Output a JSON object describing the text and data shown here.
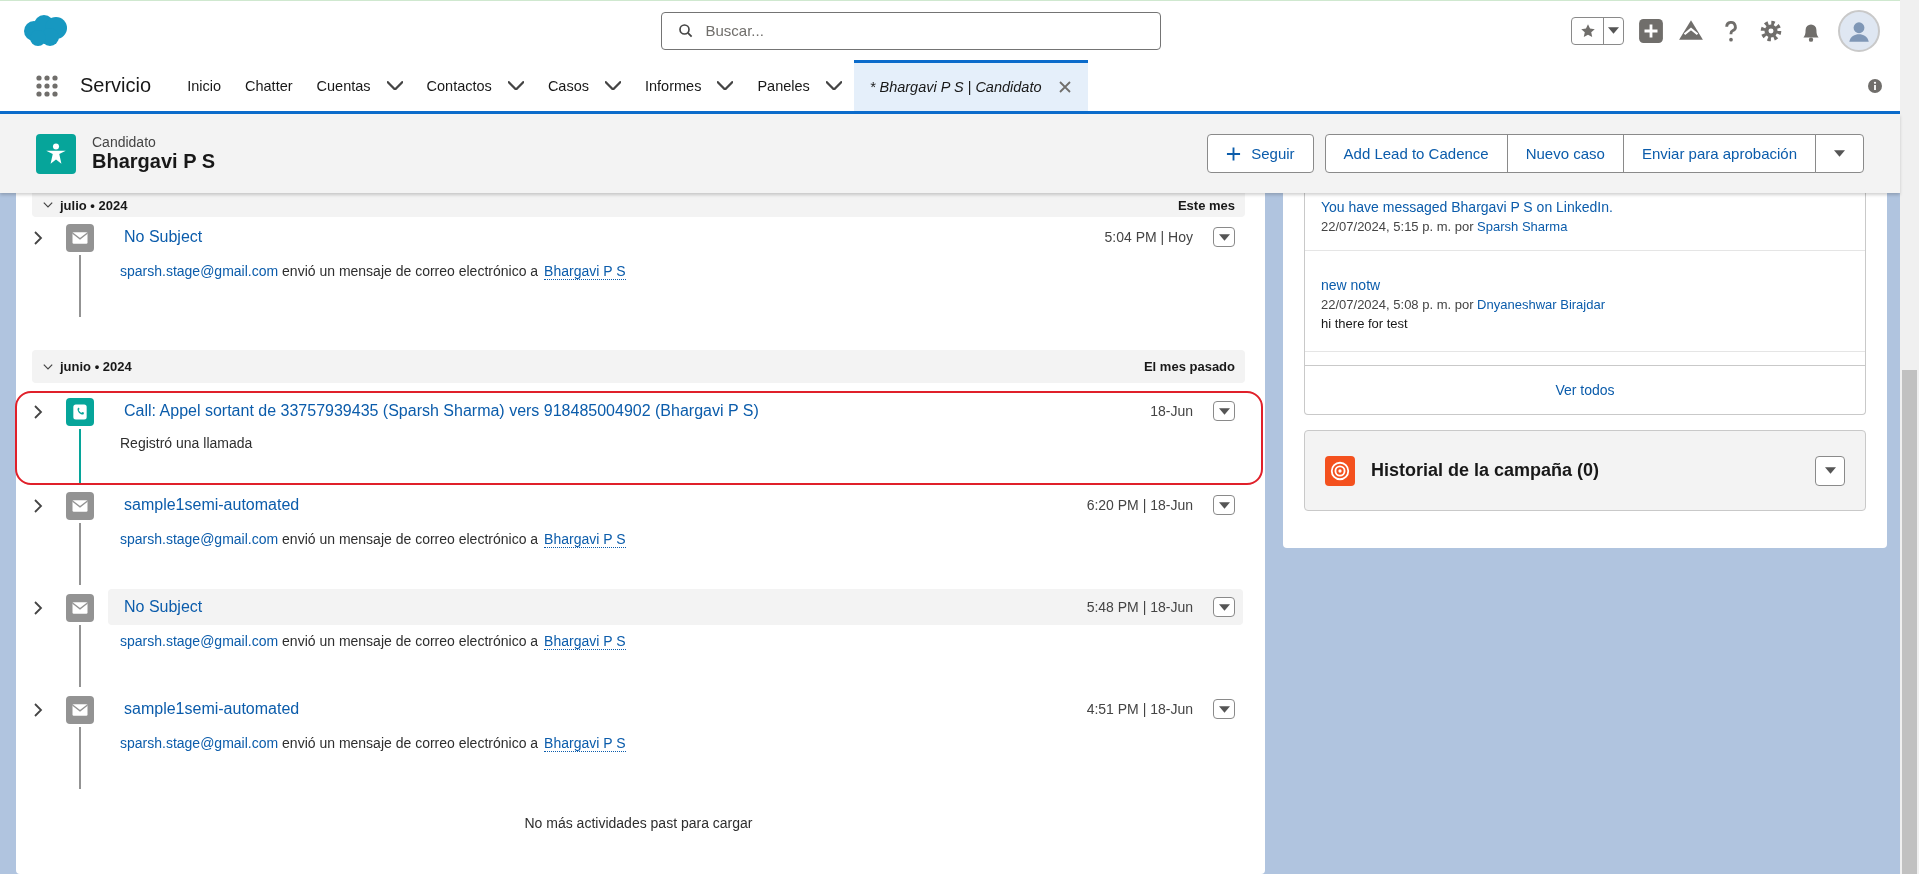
{
  "header": {
    "search": {
      "placeholder": "Buscar..."
    }
  },
  "nav": {
    "app_name": "Servicio",
    "tabs": [
      {
        "label": "Inicio",
        "has_menu": false
      },
      {
        "label": "Chatter",
        "has_menu": false
      },
      {
        "label": "Cuentas",
        "has_menu": true
      },
      {
        "label": "Contactos",
        "has_menu": true
      },
      {
        "label": "Casos",
        "has_menu": true
      },
      {
        "label": "Informes",
        "has_menu": true
      },
      {
        "label": "Paneles",
        "has_menu": true
      }
    ],
    "workspace_tabs": [
      {
        "label": "* Bhargavi P S | Candidato",
        "selected": true
      }
    ]
  },
  "record": {
    "object_type": "Candidato",
    "name": "Bhargavi P S",
    "actions": [
      {
        "label": "Seguir",
        "kind": "follow"
      },
      {
        "label": "Add Lead to Cadence",
        "kind": "action"
      },
      {
        "label": "Nuevo caso",
        "kind": "action"
      },
      {
        "label": "Enviar para aprobación",
        "kind": "action"
      }
    ]
  },
  "timeline": {
    "groups": [
      {
        "label": "julio • 2024",
        "relative": "Este mes",
        "expanded": true,
        "activities": [
          {
            "kind": "email",
            "title": "No Subject",
            "time": "5:04 PM | Hoy",
            "sender": "sparsh.stage@gmail.com",
            "action": "envió un mensaje de correo electrónico a",
            "recipient": "Bhargavi P S",
            "highlighted": false,
            "hovered": false
          }
        ]
      },
      {
        "label": "junio • 2024",
        "relative": "El mes pasado",
        "expanded": true,
        "activities": [
          {
            "kind": "call",
            "title": "Call: Appel sortant de 33757939435 (Sparsh Sharma) vers 918485004902 (Bhargavi P S)",
            "time": "18-Jun",
            "description": "Registró una llamada",
            "highlighted": true,
            "hovered": false
          },
          {
            "kind": "email",
            "title": "sample1semi-automated",
            "time": "6:20 PM | 18-Jun",
            "sender": "sparsh.stage@gmail.com",
            "action": "envió un mensaje de correo electrónico a",
            "recipient": "Bhargavi P S",
            "highlighted": false,
            "hovered": false
          },
          {
            "kind": "email",
            "title": "No Subject",
            "time": "5:48 PM | 18-Jun",
            "sender": "sparsh.stage@gmail.com",
            "action": "envió un mensaje de correo electrónico a",
            "recipient": "Bhargavi P S",
            "highlighted": false,
            "hovered": true
          },
          {
            "kind": "email",
            "title": "sample1semi-automated",
            "time": "4:51 PM | 18-Jun",
            "sender": "sparsh.stage@gmail.com",
            "action": "envió un mensaje de correo electrónico a",
            "recipient": "Bhargavi P S",
            "highlighted": false,
            "hovered": false
          }
        ]
      }
    ],
    "footer": "No más actividades past para cargar"
  },
  "notes": {
    "items": [
      {
        "title": "You have messaged Bhargavi P S on LinkedIn.",
        "date": "22/07/2024, 5:15 p. m. por",
        "author": "Sparsh Sharma"
      },
      {
        "title": "new notw",
        "date": "22/07/2024, 5:08 p. m. por",
        "author": "Dnyaneshwar Birajdar",
        "body": "hi there for test"
      }
    ],
    "view_all": "Ver todos"
  },
  "campaign": {
    "title": "Historial de la campaña (0)"
  }
}
